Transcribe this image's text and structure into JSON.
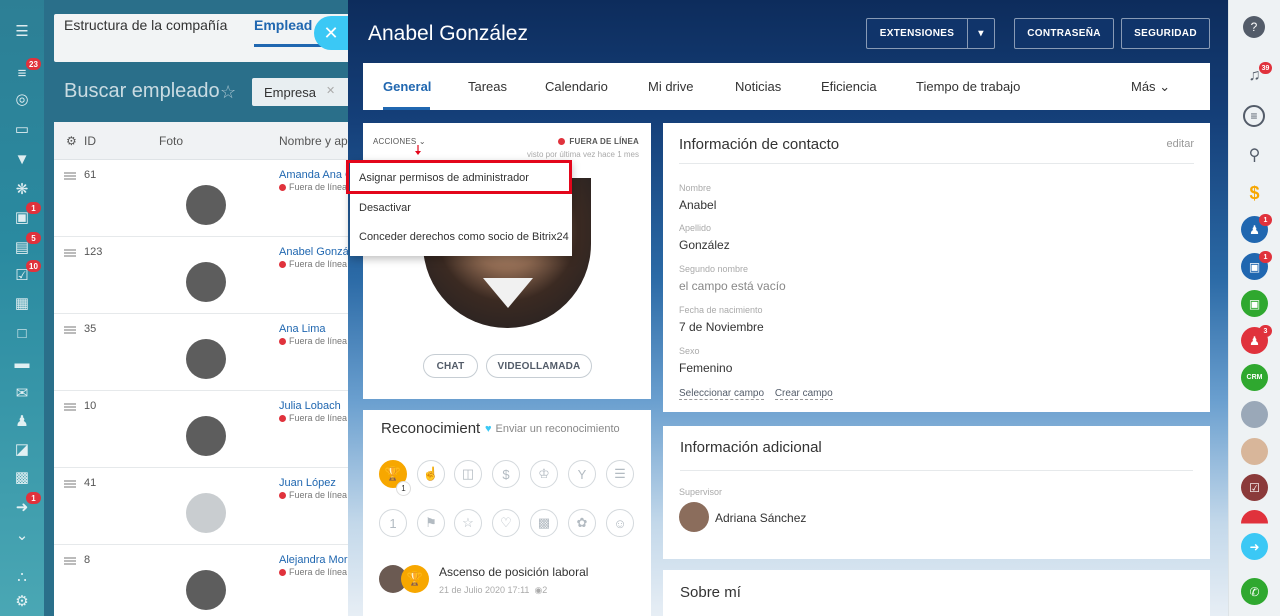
{
  "left_sidebar": {
    "badges": [
      "23",
      "1",
      "5",
      "10",
      "1"
    ]
  },
  "background_list": {
    "tab_structure": "Estructura de la compañía",
    "tab_employees": "Emplead",
    "search_title": "Buscar empleado",
    "filter_chip": "Empresa",
    "columns": {
      "id": "ID",
      "photo": "Foto",
      "name": "Nombre y ape"
    },
    "rows": [
      {
        "id": "61",
        "name": "Amanda Ana C",
        "status": "Fuera de línea"
      },
      {
        "id": "123",
        "name": "Anabel Gonzál",
        "status": "Fuera de línea"
      },
      {
        "id": "35",
        "name": "Ana Lima",
        "status": "Fuera de línea"
      },
      {
        "id": "10",
        "name": "Julia Lobach",
        "status": "Fuera de línea"
      },
      {
        "id": "41",
        "name": "Juan López",
        "status": "Fuera de línea"
      },
      {
        "id": "8",
        "name": "Alejandra Mora",
        "status": "Fuera de línea"
      }
    ]
  },
  "slider": {
    "title": "Anabel González",
    "buttons": {
      "extensions": "EXTENSIONES",
      "password": "CONTRASEÑA",
      "security": "SEGURIDAD"
    },
    "tabs": [
      "General",
      "Tareas",
      "Calendario",
      "Mi drive",
      "Noticias",
      "Eficiencia",
      "Tiempo de trabajo",
      "Más"
    ]
  },
  "profile": {
    "actions_label": "ACCIONES",
    "status": "FUERA DE LÍNEA",
    "last_seen": "visto por última vez hace 1 mes",
    "chat_button": "CHAT",
    "video_button": "VIDEOLLAMADA"
  },
  "actions_menu": {
    "items": [
      "Asignar permisos de administrador",
      "Desactivar",
      "Conceder derechos como socio de Bitrix24"
    ]
  },
  "recognition": {
    "title": "Reconocimient",
    "send_link": "Enviar un reconocimiento",
    "count": "1",
    "event_title": "Ascenso de posición laboral",
    "event_date": "21 de Julio 2020 17:11",
    "event_views": "2"
  },
  "contact": {
    "title": "Información de contacto",
    "edit": "editar",
    "fields": [
      {
        "label": "Nombre",
        "value": "Anabel"
      },
      {
        "label": "Apellido",
        "value": "González"
      },
      {
        "label": "Segundo nombre",
        "value": "el campo está vacío"
      },
      {
        "label": "Fecha de nacimiento",
        "value": "7 de Noviembre"
      },
      {
        "label": "Sexo",
        "value": "Femenino"
      }
    ],
    "select_field": "Seleccionar campo",
    "create_field": "Crear campo"
  },
  "additional": {
    "title": "Información adicional",
    "supervisor_label": "Supervisor",
    "supervisor_name": "Adriana Sánchez"
  },
  "about": {
    "title": "Sobre mí"
  },
  "right_sidebar": {
    "badges": [
      "39",
      "1",
      "1",
      "3"
    ],
    "crm_label": "CRM"
  }
}
